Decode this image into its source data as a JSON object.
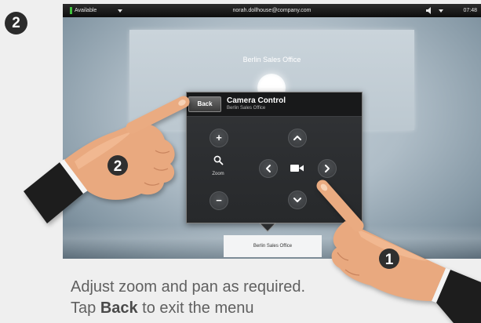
{
  "step": {
    "number": "2"
  },
  "status_bar": {
    "availability": "Available",
    "user": "norah.dollhouse@company.com",
    "time": "07:48",
    "icons": {
      "status_menu": "dropdown-arrow-icon",
      "volume": "volume-icon",
      "volume_menu": "dropdown-arrow-icon"
    }
  },
  "call_panel": {
    "title": "Berlin Sales Office"
  },
  "camera_control": {
    "back_label": "Back",
    "title": "Camera Control",
    "subtitle": "Berlin Sales Office",
    "zoom_in_label": "+",
    "zoom_label": "Zoom",
    "zoom_out_label": "−",
    "icons": {
      "zoom": "search-icon",
      "pan_up": "chevron-up-icon",
      "pan_down": "chevron-down-icon",
      "pan_left": "chevron-left-icon",
      "pan_right": "chevron-right-icon",
      "camera": "camera-icon"
    }
  },
  "call_tab": {
    "label": "Berlin Sales Office"
  },
  "hands": {
    "left_step": "2",
    "right_step": "1"
  },
  "caption": {
    "line1": "Adjust zoom and pan as required.",
    "line2_before": "Tap ",
    "line2_bold": "Back",
    "line2_after": " to exit the menu"
  },
  "colors": {
    "page_background": "#efefef",
    "availability_indicator": "#41c23e",
    "popup_background": "#2e3033",
    "caption_text": "#606060",
    "skin": "#e9a97f",
    "sleeve": "#1d1d1d"
  }
}
